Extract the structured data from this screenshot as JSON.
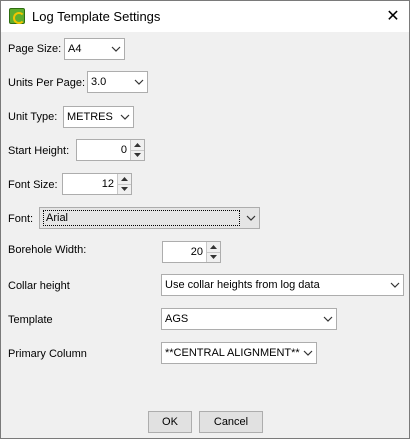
{
  "window": {
    "title": "Log Template Settings",
    "close_glyph": "✕"
  },
  "fields": {
    "page_size": {
      "label": "Page Size:",
      "value": "A4"
    },
    "units_per_page": {
      "label": "Units Per Page:",
      "value": "3.0"
    },
    "unit_type": {
      "label": "Unit Type:",
      "value": "METRES"
    },
    "start_height": {
      "label": "Start Height:",
      "value": "0"
    },
    "font_size": {
      "label": "Font Size:",
      "value": "12"
    },
    "font": {
      "label": "Font:",
      "value": "Arial"
    },
    "borehole_width": {
      "label": "Borehole Width:",
      "value": "20"
    },
    "collar_height": {
      "label": "Collar height",
      "value": "Use collar heights from log data"
    },
    "template": {
      "label": "Template",
      "value": "AGS"
    },
    "primary_column": {
      "label": "Primary Column",
      "value": "**CENTRAL ALIGNMENT**"
    }
  },
  "buttons": {
    "ok": "OK",
    "cancel": "Cancel"
  },
  "icons": {
    "app": "app-logo-icon",
    "close": "close-icon",
    "dropdown": "chevron-down-icon",
    "spin_up": "spin-up-icon",
    "spin_down": "spin-down-icon"
  }
}
